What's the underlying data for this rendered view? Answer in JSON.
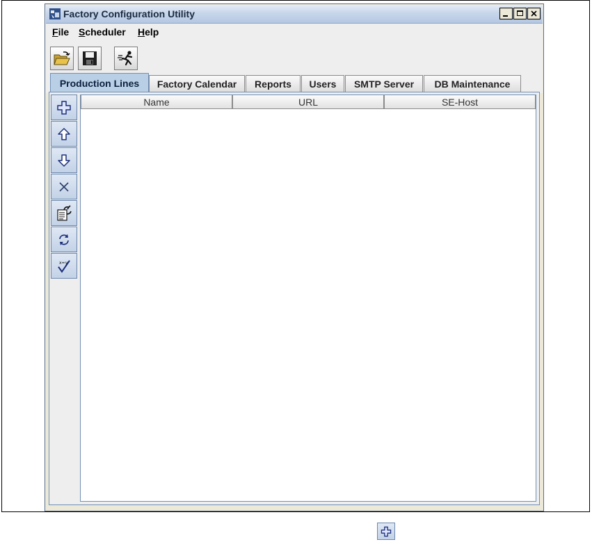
{
  "window": {
    "title": "Factory Configuration Utility",
    "controls": [
      "minimize-icon",
      "maximize-icon",
      "close-icon"
    ]
  },
  "menu": {
    "file": {
      "first": "F",
      "rest": "ile"
    },
    "scheduler": {
      "first": "S",
      "rest": "cheduler"
    },
    "help": {
      "first": "H",
      "rest": "elp"
    }
  },
  "toolbar": {
    "buttons": [
      "open-folder-icon",
      "save-disk-icon",
      "run-icon"
    ]
  },
  "tabs": [
    {
      "label": "Production Lines",
      "active": true
    },
    {
      "label": "Factory Calendar",
      "active": false
    },
    {
      "label": "Reports",
      "active": false
    },
    {
      "label": "Users",
      "active": false
    },
    {
      "label": "SMTP Server",
      "active": false
    },
    {
      "label": "DB Maintenance",
      "active": false
    }
  ],
  "side_buttons": [
    "add-icon",
    "move-up-icon",
    "move-down-icon",
    "delete-icon",
    "edit-properties-icon",
    "refresh-icon",
    "validate-icon"
  ],
  "table": {
    "columns": [
      "Name",
      "URL",
      "SE-Host"
    ],
    "rows": []
  },
  "colors": {
    "accent": "#b8cfe5",
    "window_bg": "#ece9d8"
  }
}
